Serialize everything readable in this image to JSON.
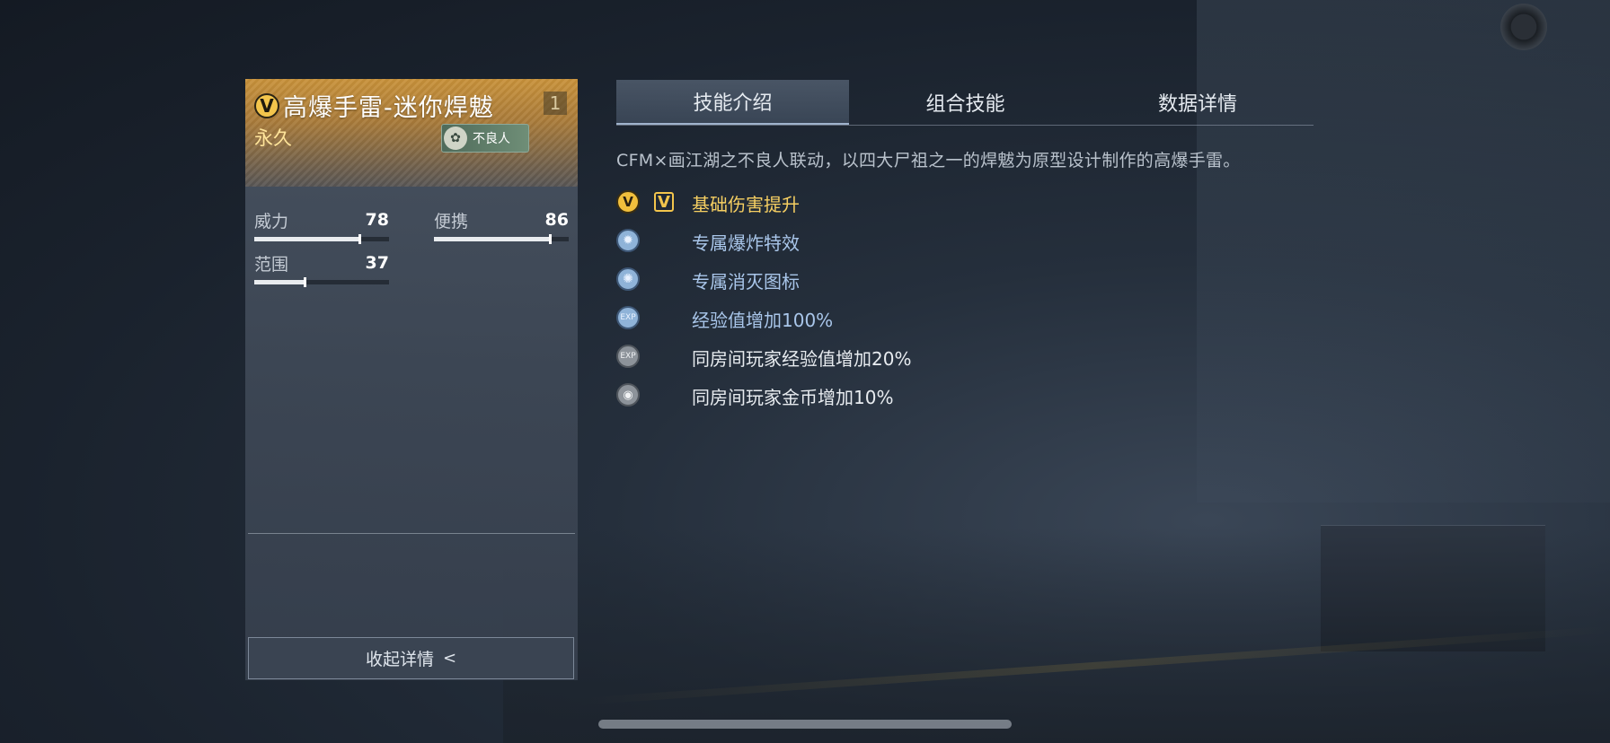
{
  "item": {
    "title": "高爆手雷-迷你焊魃",
    "rank_glyph": "V",
    "count": "1",
    "duration": "永久",
    "tag": {
      "emblem": "✿",
      "label": "不良人"
    }
  },
  "stats": [
    {
      "label": "威力",
      "value": "78",
      "fill": 0.78
    },
    {
      "label": "便携",
      "value": "86",
      "fill": 0.86
    },
    {
      "label": "范围",
      "value": "37",
      "fill": 0.37
    }
  ],
  "collapse_button": {
    "label": "收起详情",
    "icon": "chevron-left-icon",
    "glyph": "<"
  },
  "tabs": [
    {
      "label": "技能介绍",
      "active": true
    },
    {
      "label": "组合技能",
      "active": false
    },
    {
      "label": "数据详情",
      "active": false
    }
  ],
  "description": "CFM×画江湖之不良人联动，以四大尸祖之一的焊魃为原型设计制作的高爆手雷。",
  "skills": [
    {
      "icon": "v-rank-icon",
      "glyph": "V",
      "style": "gold",
      "label": "基础伤害提升"
    },
    {
      "icon": "explosion-effect-icon",
      "glyph": "✹",
      "style": "blue",
      "label": "专属爆炸特效"
    },
    {
      "icon": "kill-icon-icon",
      "glyph": "✺",
      "style": "blue",
      "label": "专属消灭图标"
    },
    {
      "icon": "exp-icon",
      "glyph": "EXP",
      "style": "blue",
      "label": "经验值增加100%"
    },
    {
      "icon": "room-exp-icon",
      "glyph": "EXP",
      "style": "gray",
      "label": "同房间玩家经验值增加20%"
    },
    {
      "icon": "room-coin-icon",
      "glyph": "◉",
      "style": "gray",
      "label": "同房间玩家金币增加10%"
    }
  ],
  "colors": {
    "gold": "#f3c54c",
    "blue_text": "#a9c6ea",
    "header_orange": "#c9923a"
  }
}
